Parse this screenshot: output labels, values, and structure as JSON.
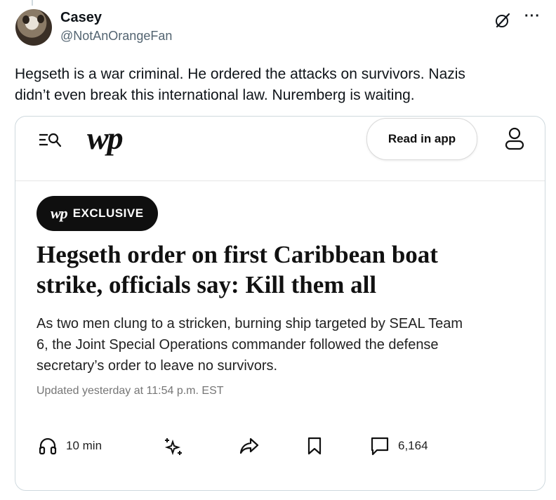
{
  "tweet": {
    "author_name": "Casey",
    "author_handle": "@NotAnOrangeFan",
    "more_label": "···",
    "text_lines": [
      "Hegseth is a war criminal.  He ordered the attacks on survivors.  Nazis",
      "didn’t even break this international law.  Nuremberg is waiting."
    ]
  },
  "article_card": {
    "header": {
      "logo": "wp",
      "read_in_app_label": "Read in app"
    },
    "badge": {
      "logo": "wp",
      "label": "EXCLUSIVE"
    },
    "headline_lines": [
      "Hegseth order on first Caribbean boat",
      "strike, officials say: Kill them all"
    ],
    "dek_lines": [
      "As two men clung to a stricken, burning ship targeted by SEAL Team",
      "6, the Joint Special Operations commander followed the defense",
      "secretary’s order to leave no survivors."
    ],
    "updated": "Updated  yesterday at 11:54 p.m. EST",
    "actions": {
      "listen_label": "10 min",
      "comments_count": "6,164"
    }
  },
  "icons": {
    "menu": "menu-search-icon",
    "user": "user-icon",
    "grok": "grok-icon",
    "listen": "headphones-icon",
    "gift": "sparkle-icon",
    "share": "share-arrow-icon",
    "save": "bookmark-icon",
    "comments": "comment-icon"
  }
}
